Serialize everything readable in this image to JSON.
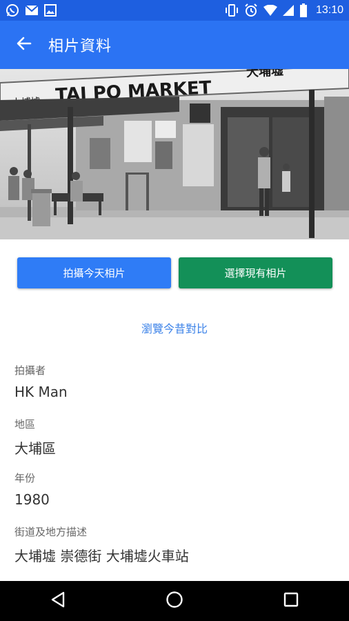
{
  "status_bar": {
    "time": "13:10",
    "left_icons": [
      "whatsapp-icon",
      "gmail-icon",
      "image-icon"
    ],
    "right_icons": [
      "vibrate-icon",
      "alarm-icon",
      "wifi-icon",
      "signal-icon",
      "battery-icon"
    ]
  },
  "app_bar": {
    "title": "相片資料",
    "back_icon": "arrow-back-icon"
  },
  "photo": {
    "sign_text": "TAI PO MARKET",
    "sign_chinese": "大埔墟",
    "sign_chinese_right": "大埔墟"
  },
  "actions": {
    "take_today_photo": "拍攝今天相片",
    "choose_existing_photo": "選擇現有相片",
    "browse_compare": "瀏覽今昔對比"
  },
  "details": [
    {
      "label": "拍攝者",
      "value": "HK Man"
    },
    {
      "label": "地區",
      "value": "大埔區"
    },
    {
      "label": "年份",
      "value": "1980"
    },
    {
      "label": "街道及地方描述",
      "value": "大埔墟 崇德街 大埔墟火車站"
    }
  ],
  "colors": {
    "status_bar": "#1e5fe0",
    "app_bar": "#2b73f3",
    "primary_button": "#2f7cf6",
    "secondary_button": "#139058",
    "link": "#3b82e8"
  },
  "nav_bar": {
    "icons": [
      "back-triangle-icon",
      "home-circle-icon",
      "recents-square-icon"
    ]
  }
}
